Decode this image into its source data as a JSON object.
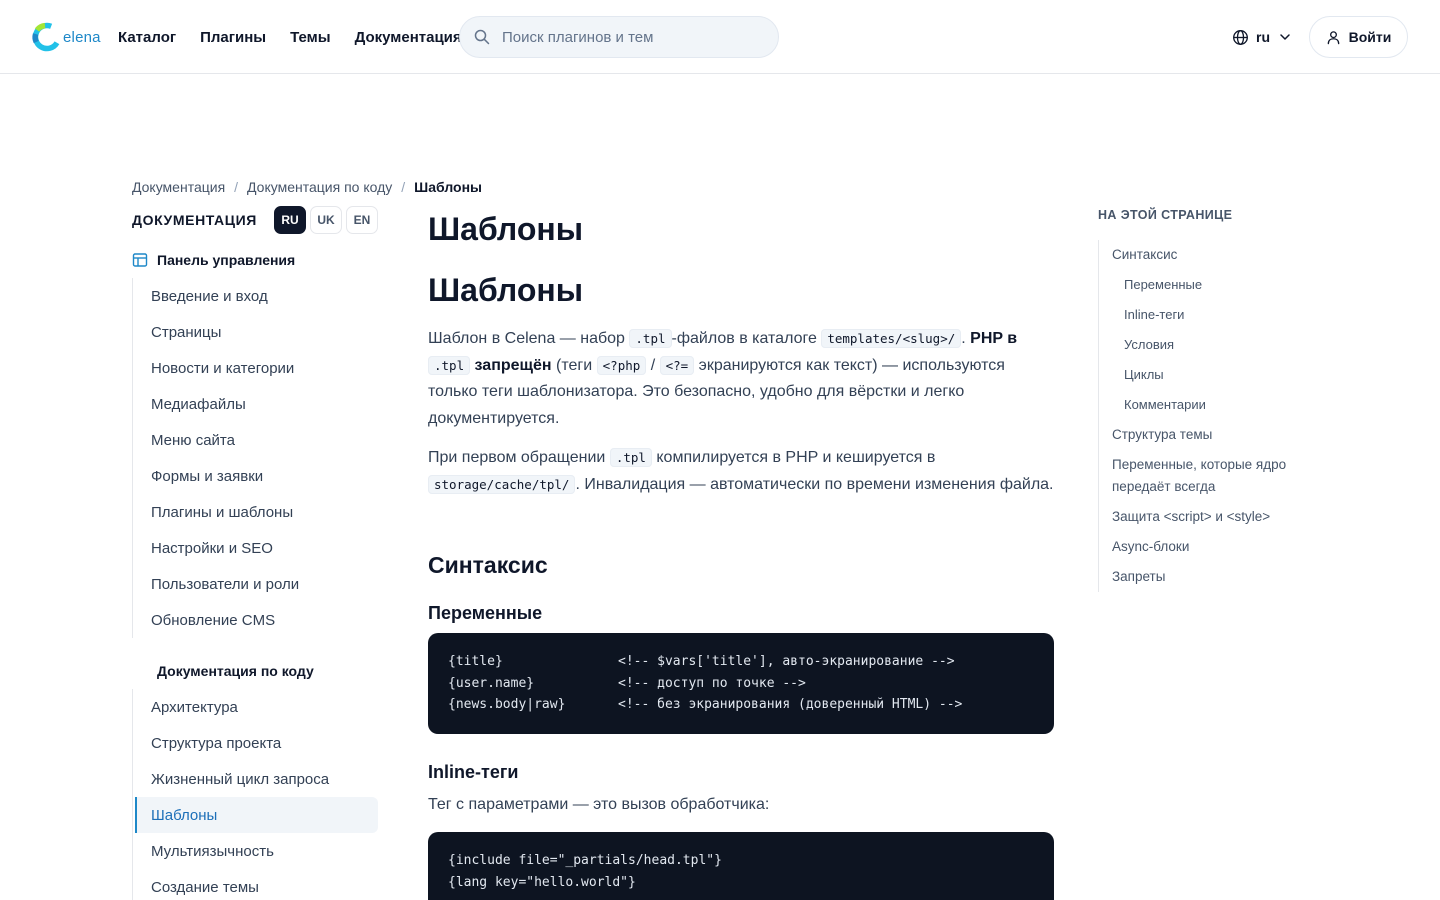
{
  "header": {
    "logo_text": "elena",
    "nav": [
      "Каталог",
      "Плагины",
      "Темы",
      "Документация"
    ],
    "search_placeholder": "Поиск плагинов и тем",
    "lang": "ru",
    "login": "Войти",
    "accent": "#1e88c8"
  },
  "breadcrumb": [
    "Документация",
    "Документация по коду",
    "Шаблоны"
  ],
  "sidebar": {
    "title": "ДОКУМЕНТАЦИЯ",
    "langs": [
      "RU",
      "UK",
      "EN"
    ],
    "group1": {
      "title": "Панель управления",
      "items": [
        "Введение и вход",
        "Страницы",
        "Новости и категории",
        "Медиафайлы",
        "Меню сайта",
        "Формы и заявки",
        "Плагины и шаблоны",
        "Настройки и SEO",
        "Пользователи и роли",
        "Обновление CMS"
      ]
    },
    "group2": {
      "title": "Документация по коду",
      "items": [
        "Архитектура",
        "Структура проекта",
        "Жизненный цикл запроса",
        "Шаблоны",
        "Мультиязычность",
        "Создание темы"
      ]
    }
  },
  "main": {
    "title1": "Шаблоны",
    "title2": "Шаблоны",
    "p1": {
      "t1": "Шаблон в Celena — набор ",
      "c1": ".tpl",
      "t2": "-файлов в каталоге ",
      "c2": "templates/<slug>/",
      "t3": ". ",
      "b1": "PHP в",
      "c3": ".tpl",
      "b2": " запрещён",
      "t4": " (теги ",
      "c4": "<?php",
      "t5": " / ",
      "c5": "<?=",
      "t6": " экранируются как текст) — используются только теги шаблонизатора. Это безопасно, удобно для вёрстки и легко документируется."
    },
    "p2": {
      "t1": "При первом обращении ",
      "c1": ".tpl",
      "t2": " компилируется в PHP и кешируется в ",
      "c2": "storage/cache/tpl/",
      "t3": ". Инвалидация — автоматически по времени изменения файла."
    },
    "h_syntax": "Синтаксис",
    "h_vars": "Переменные",
    "code_vars": [
      {
        "code": "{title}",
        "comment": "<!-- $vars['title'], авто-экранирование -->"
      },
      {
        "code": "{user.name}",
        "comment": "<!-- доступ по точке -->"
      },
      {
        "code": "{news.body|raw}",
        "comment": "<!-- без экранирования (доверенный HTML) -->"
      }
    ],
    "h_inline": "Inline-теги",
    "inline_text": "Тег с параметрами — это вызов обработчика:",
    "code_inline": [
      "{include file=\"_partials/head.tpl\"}",
      "{lang key=\"hello.world\"}"
    ]
  },
  "toc": {
    "title": "НА ЭТОЙ СТРАНИЦЕ",
    "items": [
      {
        "label": "Синтаксис",
        "sub": false
      },
      {
        "label": "Переменные",
        "sub": true
      },
      {
        "label": "Inline-теги",
        "sub": true
      },
      {
        "label": "Условия",
        "sub": true
      },
      {
        "label": "Циклы",
        "sub": true
      },
      {
        "label": "Комментарии",
        "sub": true
      },
      {
        "label": "Структура темы",
        "sub": false
      },
      {
        "label": "Переменные, которые ядро передаёт всегда",
        "sub": false
      },
      {
        "label": "Защита <script> и <style>",
        "sub": false
      },
      {
        "label": "Async-блоки",
        "sub": false
      },
      {
        "label": "Запреты",
        "sub": false
      }
    ]
  }
}
